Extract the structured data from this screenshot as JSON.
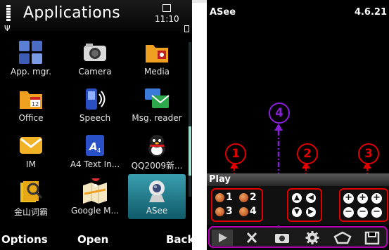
{
  "left": {
    "title": "Applications",
    "clock": "11:10",
    "apps": [
      {
        "label": "App. mgr.",
        "icon": "app-manager-icon"
      },
      {
        "label": "Camera",
        "icon": "camera-icon"
      },
      {
        "label": "Media",
        "icon": "media-icon"
      },
      {
        "label": "Office",
        "icon": "office-icon"
      },
      {
        "label": "Speech",
        "icon": "speech-icon"
      },
      {
        "label": "Msg. reader",
        "icon": "msg-reader-icon"
      },
      {
        "label": "IM",
        "icon": "im-icon"
      },
      {
        "label": "A4 Text In...",
        "icon": "a4-text-icon"
      },
      {
        "label": "QQ2009新...",
        "icon": "qq-icon"
      },
      {
        "label": "金山词霸",
        "icon": "dictionary-icon"
      },
      {
        "label": "Google M...",
        "icon": "google-maps-icon"
      },
      {
        "label": "ASee",
        "icon": "asee-webcam-icon"
      }
    ],
    "softkeys": {
      "left": "Options",
      "center": "Open",
      "right": "Back"
    }
  },
  "right": {
    "app_title": "ASee",
    "version": "4.6.21",
    "status_label": "Play",
    "callouts": [
      "1",
      "2",
      "3",
      "4"
    ],
    "channels": [
      "1",
      "2",
      "3",
      "4"
    ],
    "colors": {
      "callout_red": "#e00000",
      "callout_purple": "#8a1fd8",
      "toolbar_border": "#b400b4"
    }
  }
}
